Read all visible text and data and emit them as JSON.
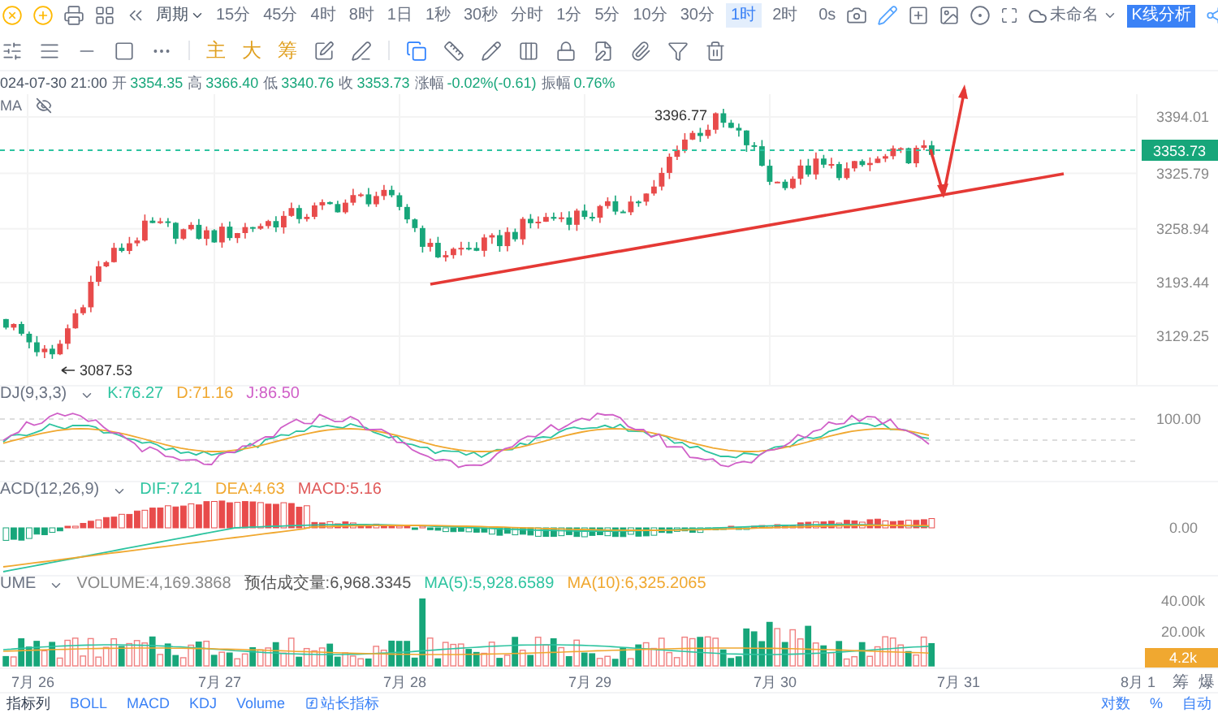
{
  "toolbar": {
    "period_label": "周期",
    "intervals": [
      {
        "label": "15分",
        "selected": false
      },
      {
        "label": "45分",
        "selected": false
      },
      {
        "label": "4时",
        "selected": false
      },
      {
        "label": "8时",
        "selected": false
      },
      {
        "label": "1日",
        "selected": false
      },
      {
        "label": "1秒",
        "selected": false
      },
      {
        "label": "30秒",
        "selected": false
      },
      {
        "label": "分时",
        "selected": false
      },
      {
        "label": "1分",
        "selected": false
      },
      {
        "label": "5分",
        "selected": false
      },
      {
        "label": "10分",
        "selected": false
      },
      {
        "label": "30分",
        "selected": false
      },
      {
        "label": "1时",
        "selected": true
      },
      {
        "label": "2时",
        "selected": false
      }
    ],
    "delay": "0s",
    "layout_name": "未命名",
    "analysis_button": "K线分析"
  },
  "drawing_toolbar": {
    "indicator_buttons": [
      "主",
      "大",
      "筹"
    ]
  },
  "ohlc_bar": {
    "datetime": "024-07-30 21:00",
    "fields": [
      {
        "label": "开",
        "value": "3354.35"
      },
      {
        "label": "高",
        "value": "3366.40"
      },
      {
        "label": "低",
        "value": "3340.76"
      },
      {
        "label": "收",
        "value": "3353.73"
      },
      {
        "label": "涨幅",
        "value": "-0.02%(-0.61)"
      },
      {
        "label": "振幅",
        "value": "0.76%"
      }
    ]
  },
  "ma_label": "MA",
  "main_chart": {
    "price_labels": [
      "3394.01",
      "3325.79",
      "3258.94",
      "3193.44",
      "3129.25"
    ],
    "last_price": "3353.73",
    "high_marker": "3396.77",
    "low_marker": "3087.53"
  },
  "kdj": {
    "name": "DJ(9,3,3)",
    "values": [
      {
        "text": "K:76.27",
        "color": "#2ec4a0"
      },
      {
        "text": "D:71.16",
        "color": "#f0a830"
      },
      {
        "text": "J:86.50",
        "color": "#d060c8"
      }
    ],
    "axis_labels": [
      "100.00"
    ]
  },
  "macd": {
    "name": "ACD(12,26,9)",
    "values": [
      {
        "text": "DIF:7.21",
        "color": "#2ec4a0"
      },
      {
        "text": "DEA:4.63",
        "color": "#f0a830"
      },
      {
        "text": "MACD:5.16",
        "color": "#e05a5a"
      }
    ],
    "axis_labels": [
      "0.00"
    ]
  },
  "volume": {
    "name": "UME",
    "values": [
      {
        "text": "VOLUME:4,169.3868",
        "color": "#888888"
      },
      {
        "text": "预估成交量:6,968.3345",
        "color": "#555555"
      },
      {
        "text": "MA(5):5,928.6589",
        "color": "#2ec4a0"
      },
      {
        "text": "MA(10):6,325.2065",
        "color": "#f0a830"
      }
    ],
    "axis_labels": [
      "40.00k",
      "20.00k"
    ],
    "last_volume": "4.2k"
  },
  "x_axis": [
    "7月 26",
    "7月 27",
    "7月 28",
    "7月 29",
    "7月 30",
    "7月 31",
    "8月 1"
  ],
  "side_buttons": [
    "筹",
    "爆"
  ],
  "bottom_tabs": [
    "指标列",
    "BOLL",
    "MACD",
    "KDJ",
    "Volume",
    "站长指标"
  ],
  "bottom_right": [
    "对数",
    "%",
    "自动"
  ]
}
